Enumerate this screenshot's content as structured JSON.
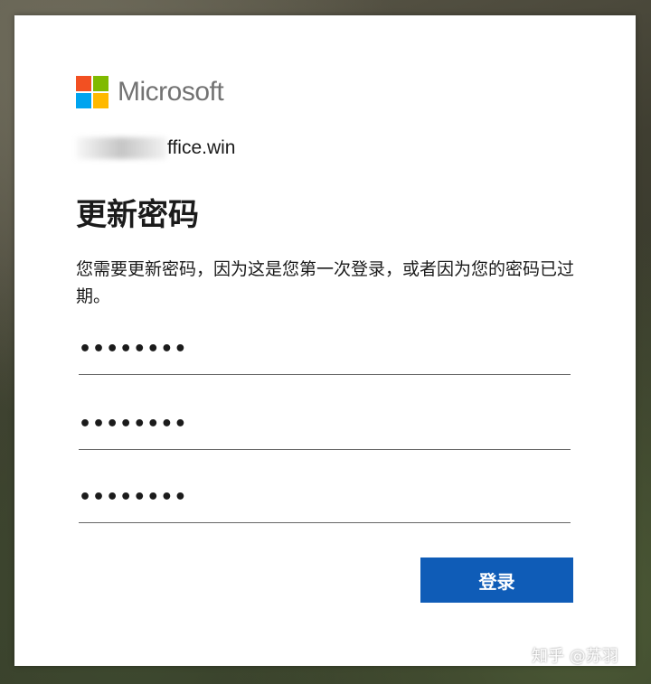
{
  "brand": {
    "name": "Microsoft",
    "colors": {
      "red": "#f25022",
      "green": "#7fba00",
      "blue": "#00a4ef",
      "yellow": "#ffb900"
    }
  },
  "account": {
    "visible_suffix": "ffice.win"
  },
  "form": {
    "title": "更新密码",
    "description": "您需要更新密码，因为这是您第一次登录，或者因为您的密码已过期。",
    "fields": [
      {
        "masked_value": "••••••••"
      },
      {
        "masked_value": "••••••••"
      },
      {
        "masked_value": "••••••••"
      }
    ],
    "submit_label": "登录",
    "accent": "#0f5cb7"
  },
  "watermark": "知乎 @苏羽"
}
